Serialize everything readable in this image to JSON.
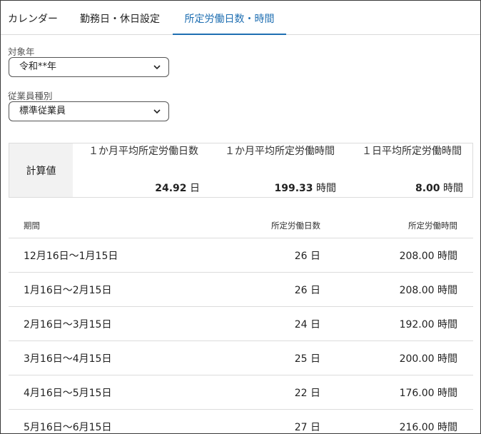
{
  "tabs": [
    {
      "label": "カレンダー"
    },
    {
      "label": "勤務日・休日設定"
    },
    {
      "label": "所定労働日数・時間"
    }
  ],
  "fields": {
    "year": {
      "label": "対象年",
      "value": "令和**年"
    },
    "employee_type": {
      "label": "従業員種別",
      "value": "標準従業員"
    }
  },
  "summary": {
    "header": "計算値",
    "items": [
      {
        "label": "１か月平均所定労働日数",
        "value": "24.92",
        "unit": "日"
      },
      {
        "label": "１か月平均所定労働時間",
        "value": "199.33",
        "unit": "時間"
      },
      {
        "label": "１日平均所定労働時間",
        "value": "8.00",
        "unit": "時間"
      }
    ]
  },
  "table": {
    "headers": {
      "period": "期間",
      "days": "所定労働日数",
      "hours": "所定労働時間"
    },
    "rows": [
      {
        "period": "12月16日〜1月15日",
        "days": "26 日",
        "hours": "208.00 時間"
      },
      {
        "period": "1月16日〜2月15日",
        "days": "26 日",
        "hours": "208.00 時間"
      },
      {
        "period": "2月16日〜3月15日",
        "days": "24 日",
        "hours": "192.00 時間"
      },
      {
        "period": "3月16日〜4月15日",
        "days": "25 日",
        "hours": "200.00 時間"
      },
      {
        "period": "4月16日〜5月15日",
        "days": "22 日",
        "hours": "176.00 時間"
      },
      {
        "period": "5月16日〜6月15日",
        "days": "27 日",
        "hours": "216.00 時間"
      }
    ]
  },
  "colors": {
    "accent": "#1f6fb2",
    "header_bg": "#f2f2f2",
    "border": "#dcdcdc"
  }
}
